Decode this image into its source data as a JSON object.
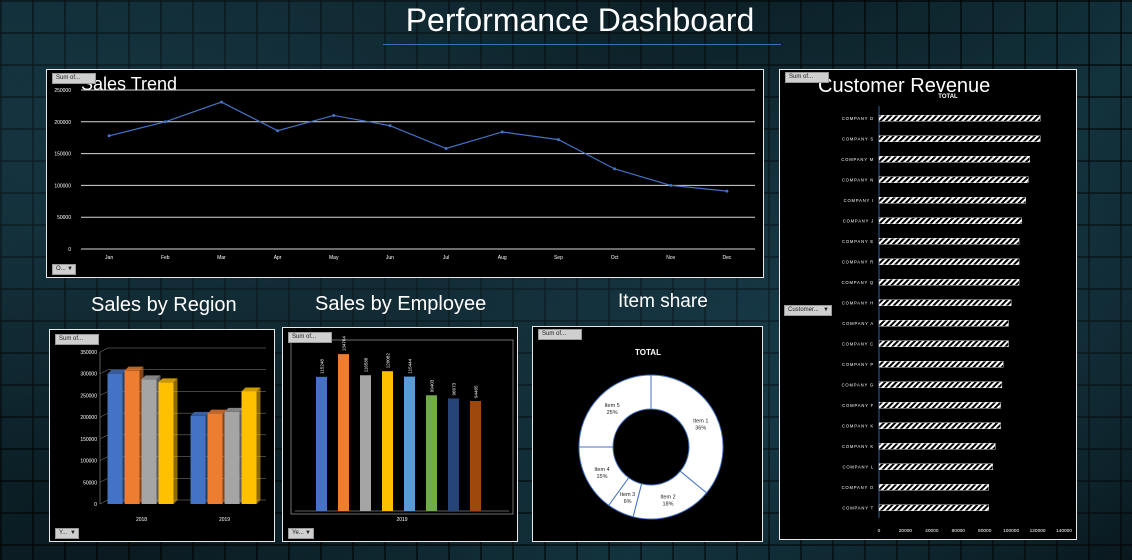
{
  "dashboard": {
    "title": "Performance Dashboard"
  },
  "sales_trend": {
    "title": "Sales Trend",
    "field_button": "Sum of...",
    "filter_button": "O..."
  },
  "sales_by_region": {
    "title": "Sales by Region",
    "field_button": "Sum of...",
    "filter_button": "Y..."
  },
  "sales_by_employee": {
    "title": "Sales by Employee",
    "field_button": "Sum of...",
    "filter_button": "Ye..."
  },
  "item_share": {
    "title": "Item share",
    "field_button": "Sum of..."
  },
  "customer_revenue": {
    "title": "Customer Revenue",
    "field_button": "Sum of...",
    "filter_button": "Customer..."
  },
  "colors": {
    "line": "#4472C4",
    "grid": "#ffffff",
    "bar_hatch": "#ffffff"
  },
  "chart_data": [
    {
      "id": "sales_trend",
      "type": "line",
      "x": [
        "Jan",
        "Feb",
        "Mar",
        "Apr",
        "May",
        "Jun",
        "Jul",
        "Aug",
        "Sep",
        "Oct",
        "Nov",
        "Dec"
      ],
      "values": [
        178000,
        200000,
        231000,
        186000,
        210000,
        194000,
        158000,
        184000,
        172000,
        126000,
        100000,
        91000
      ],
      "ylim": [
        0,
        250000
      ],
      "yticks": [
        0,
        50000,
        100000,
        150000,
        200000,
        250000
      ],
      "grid": true
    },
    {
      "id": "sales_by_region",
      "type": "bar",
      "categories": [
        "2018",
        "2019"
      ],
      "series": [
        {
          "color": "#4472C4",
          "values": [
            300000,
            203000
          ]
        },
        {
          "color": "#ED7D31",
          "values": [
            307000,
            208000
          ]
        },
        {
          "color": "#A5A5A5",
          "values": [
            287000,
            212000
          ]
        },
        {
          "color": "#FFC000",
          "values": [
            280000,
            259000
          ]
        }
      ],
      "ylim": [
        0,
        350000
      ],
      "yticks": [
        0,
        50000,
        100000,
        150000,
        200000,
        250000,
        300000,
        350000
      ]
    },
    {
      "id": "sales_by_employee",
      "type": "bar",
      "categories": [
        "2019"
      ],
      "values": [
        115248,
        134764,
        116588,
        120082,
        115444,
        99403,
        96673,
        94465
      ],
      "colors": [
        "#4472C4",
        "#ED7D31",
        "#A5A5A5",
        "#FFC000",
        "#5B9BD5",
        "#70AD47",
        "#264478",
        "#9E480E"
      ]
    },
    {
      "id": "item_share",
      "type": "pie",
      "title": "TOTAL",
      "labels": [
        "Item 1",
        "Item 2",
        "Item 3",
        "Item 4",
        "Item 5"
      ],
      "values": [
        36,
        18,
        6,
        15,
        25
      ],
      "percent_labels": [
        "36%",
        "18%",
        "6%",
        "15%",
        "25%"
      ]
    },
    {
      "id": "customer_revenue",
      "type": "bar",
      "title": "TOTAL",
      "categories": [
        "COMPANY D",
        "COMPANY S",
        "COMPANY M",
        "COMPANY N",
        "COMPANY I",
        "COMPANY J",
        "COMPANY E",
        "COMPANY R",
        "COMPANY Q",
        "COMPANY H",
        "COMPANY A",
        "COMPANY C",
        "COMPANY P",
        "COMPANY G",
        "COMPANY F",
        "COMPANY K",
        "COMPANY K",
        "COMPANY L",
        "COMPANY O",
        "COMPANY T"
      ],
      "values": [
        122000,
        122000,
        114000,
        113000,
        111000,
        108000,
        106000,
        106000,
        106000,
        100000,
        98000,
        98000,
        94000,
        93000,
        92000,
        92000,
        88000,
        86000,
        83000,
        83000
      ],
      "xlim": [
        0,
        140000
      ],
      "xticks": [
        "0",
        "20000",
        "40000",
        "60000",
        "80000",
        "100000",
        "120000",
        "140000"
      ]
    }
  ]
}
